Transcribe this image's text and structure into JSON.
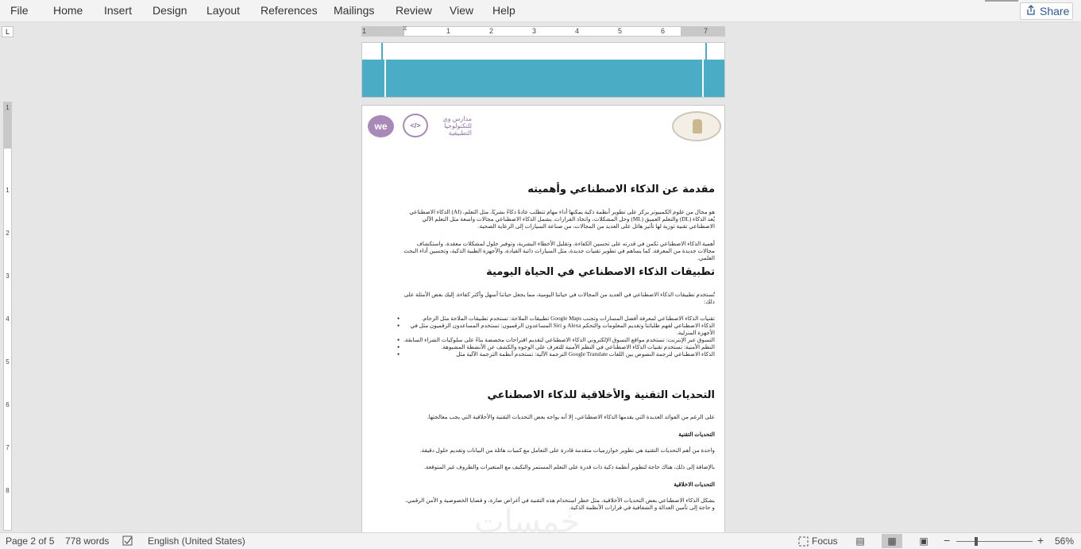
{
  "menu": {
    "items": [
      "File",
      "Home",
      "Insert",
      "Design",
      "Layout",
      "References",
      "Mailings",
      "Review",
      "View",
      "Help"
    ],
    "share_label": "Share"
  },
  "ruler": {
    "tab_selector": "L",
    "h_ticks": [
      "1",
      "1",
      "2",
      "3",
      "4",
      "5",
      "6",
      "7"
    ],
    "v_ticks": [
      "1",
      "1",
      "2",
      "3",
      "4",
      "5",
      "6",
      "7",
      "8"
    ]
  },
  "logos": {
    "we_text": "we",
    "school_mark": "</>",
    "school_text": "مدارس وي للتكنولوجيا التطبيقية"
  },
  "document": {
    "heading_1": "مقدمة عن الذكاء الاصطناعي وأهميته",
    "para_1": "هو مجال من علوم الكمبيوتر يركز على تطوير أنظمة ذكية يمكنها أداء مهام تتطلب عادةً ذكاءً بشريًا، مثل التعلم، (AI) الذكاء الاصطناعي يُعد الذكاء (DL) والتعلم العميق (ML) وحل المشكلات، واتخاذ القرارات. يشمل الذكاء الاصطناعي مجالات واسعة مثل التعلم الآلي الاصطناعي تقنية ثورية لها تأثير هائل على العديد من المجالات، من صناعة السيارات إلى الرعاية الصحية.",
    "para_2": "أهمية الذكاء الاصطناعي تكمن في قدرته على تحسين الكفاءة، وتقليل الأخطاء البشرية، وتوفير حلول لمشكلات معقدة، واستكشاف مجالات جديدة من المعرفة. كما يساهم في تطوير تقنيات جديدة، مثل السيارات ذاتية القيادة، والأجهزة الطبية الذكية، وتحسين أداء البحث العلمي.",
    "heading_2": "تطبيقات الذكاء الاصطناعي في الحياة اليومية",
    "para_3": "تُستخدم تطبيقات الذكاء الاصطناعي في العديد من المجالات في حياتنا اليومية، مما يجعل حياتنا أسهل وأكثر كفاءة. إليك بعض الأمثلة على ذلك:",
    "bullets": [
      "تقنيات الذكاء الاصطناعي لمعرفة أفضل المسارات وتجنب Google Maps تطبيقات الملاحة: تستخدم تطبيقات الملاحة مثل الزحام.",
      "الذكاء الاصطناعي لفهم طلباتنا وتقديم المعلومات والتحكم Alexa و Siri المساعدون الرقميون: تستخدم المساعدون الرقميون مثل في الأجهزة المنزلية.",
      "التسوق عبر الإنترنت: تستخدم مواقع التسوق الإلكتروني الذكاء الاصطناعي لتقديم اقتراحات مخصصة بناءً على سلوكيات الشراء السابقة.",
      "النظم الأمنية: تستخدم تقنيات الذكاء الاصطناعي في النظم الأمنية للتعرف على الوجوه والكشف عن الأنشطة المشبوهة.",
      "الذكاء الاصطناعي لترجمة النصوص بين اللغات Google Translate الترجمة الآلية: تستخدم أنظمة الترجمة الآلية مثل"
    ],
    "heading_3": "التحديات التقنية والأخلاقية للذكاء الاصطناعي",
    "para_4": "على الرغم من الفوائد العديدة التي يقدمها الذكاء الاصطناعي، إلا أنه يواجه بعض التحديات التقنية والأخلاقية التي يجب معالجتها.",
    "sub_1": "التحديات التقنية",
    "para_5": "واحدة من أهم التحديات التقنية هي تطوير خوارزميات متقدمة قادرة على التعامل مع كميات هائلة من البيانات وتقديم حلول دقيقة.",
    "para_6": "بالإضافة إلى ذلك، هناك حاجة لتطوير أنظمة ذكية ذات قدرة على التعلم المستمر والتكيف مع المتغيرات والظروف غير المتوقعة.",
    "sub_2": "التحديات الاخلاقية",
    "para_7": "يشكل الذكاء الاصطناعي بعض التحديات الأخلاقية، مثل خطر استخدام هذه التقنية في أغراض ضارة، و قضايا الخصوصية و الأمن الرقمي، و حاجة إلى تأمين العدالة و الشفافية في قرارات الأنظمة الذكية."
  },
  "watermark": "خمسات",
  "status": {
    "page": "Page 2 of 5",
    "words": "778 words",
    "language": "English (United States)",
    "focus_label": "Focus",
    "zoom": "56%",
    "zoom_minus": "−",
    "zoom_plus": "+"
  },
  "colors": {
    "accent": "#2b579a",
    "cover_band": "#4bacc6",
    "logo_purple": "#a889b8"
  },
  "icons": [
    "share-icon",
    "proofing-icon",
    "focus-icon",
    "read-mode-icon",
    "print-layout-icon",
    "web-layout-icon"
  ]
}
